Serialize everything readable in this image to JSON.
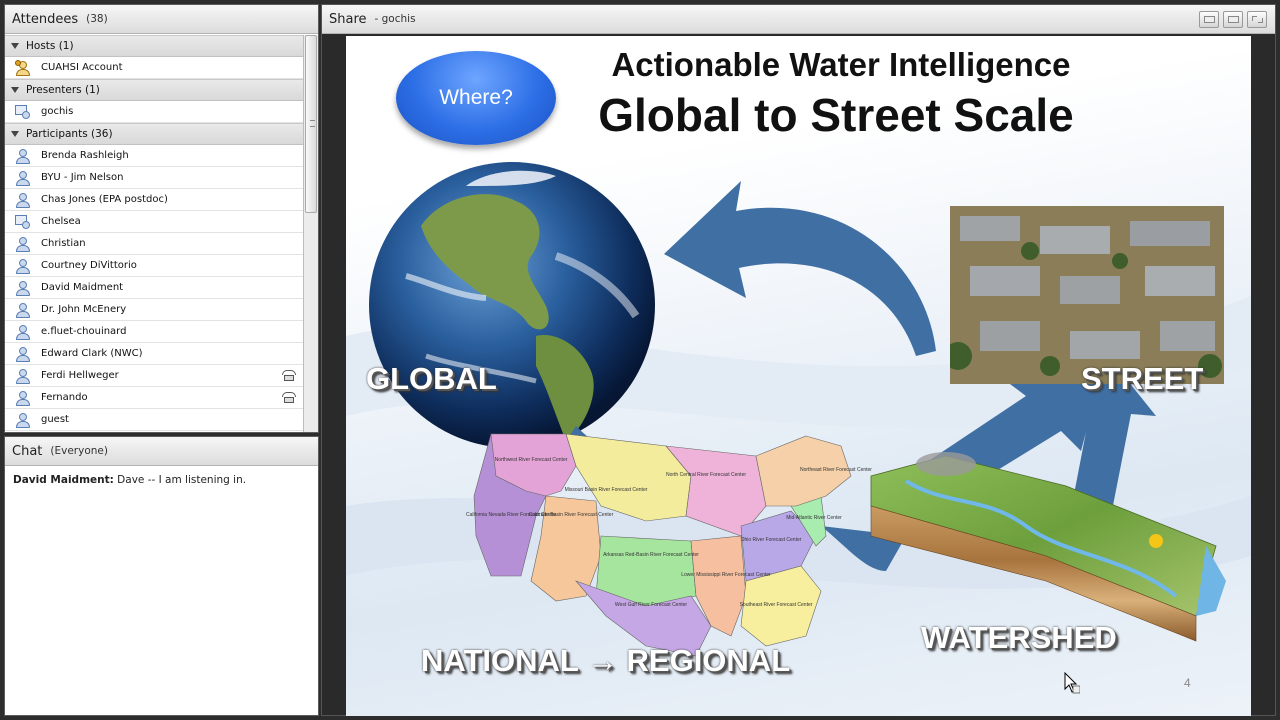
{
  "attendees": {
    "title": "Attendees",
    "count": "(38)",
    "groups": [
      {
        "label": "Hosts (1)",
        "members": [
          {
            "name": "CUAHSI Account",
            "role": "host"
          }
        ]
      },
      {
        "label": "Presenters (1)",
        "members": [
          {
            "name": "gochis",
            "role": "presenter"
          }
        ]
      },
      {
        "label": "Participants (36)",
        "members": [
          {
            "name": "Brenda Rashleigh",
            "role": "participant"
          },
          {
            "name": "BYU - Jim Nelson",
            "role": "participant"
          },
          {
            "name": "Chas Jones (EPA postdoc)",
            "role": "participant"
          },
          {
            "name": "Chelsea",
            "role": "presenter"
          },
          {
            "name": "Christian",
            "role": "participant"
          },
          {
            "name": "Courtney DiVittorio",
            "role": "participant"
          },
          {
            "name": "David Maidment",
            "role": "participant"
          },
          {
            "name": "Dr. John McEnery",
            "role": "participant"
          },
          {
            "name": "e.fluet-chouinard",
            "role": "participant"
          },
          {
            "name": "Edward Clark (NWC)",
            "role": "participant"
          },
          {
            "name": "Ferdi Hellweger",
            "role": "participant",
            "phone": true
          },
          {
            "name": "Fernando",
            "role": "participant",
            "phone": true
          },
          {
            "name": "guest",
            "role": "participant"
          }
        ]
      }
    ]
  },
  "chat": {
    "title": "Chat",
    "scope": "(Everyone)",
    "messages": [
      {
        "sender": "David Maidment:",
        "text": "Dave -- I am listening in."
      }
    ]
  },
  "share": {
    "title": "Share",
    "presenter": "- gochis"
  },
  "slide": {
    "button": "Where?",
    "title_line1": "Actionable Water Intelligence",
    "title_line2": "Global to Street Scale",
    "label_global": "GLOBAL",
    "label_street": "STREET",
    "label_watershed": "WATERSHED",
    "label_national": "NATIONAL → REGIONAL",
    "page_number": "4",
    "map_labels": [
      "Northwest River Forecast Center",
      "Missouri Basin River Forecast Center",
      "North Central River Forecast Center",
      "California Nevada River Forecast Center",
      "Colorado Basin River Forecast Center",
      "Arkansas Red-Basin River Forecast Center",
      "Ohio River Forecast Center",
      "Mid-Atlantic River Center",
      "Lower Mississippi River Forecast Center",
      "West Gulf River Forecast Center",
      "Southeast River Forecast Center",
      "Northeast River Forecast Center"
    ]
  },
  "colors": {
    "arrow": "#3f6fa3",
    "button": "#2d6fe6"
  }
}
